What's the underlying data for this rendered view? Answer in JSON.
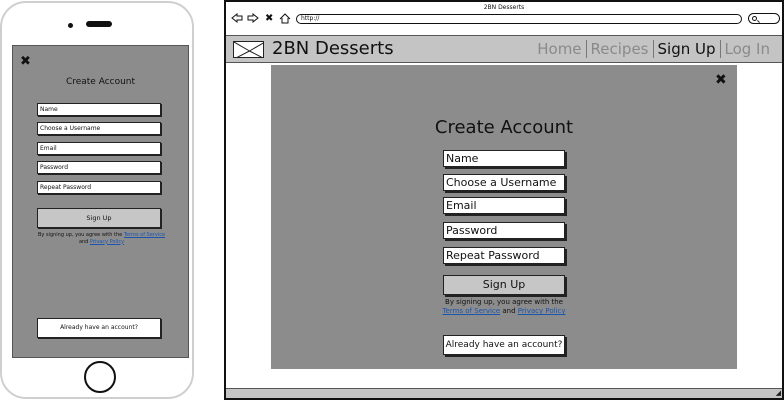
{
  "phone": {
    "close_icon": "close-icon",
    "title": "Create Account",
    "fields": [
      "Name",
      "Choose a Username",
      "Email",
      "Password",
      "Repeat Password"
    ],
    "signup_label": "Sign Up",
    "terms_prefix": "By signing up, you agree with the",
    "terms_link": "Terms of Service",
    "terms_and": "and",
    "privacy_link": "Privacy Policy",
    "account_label": "Already have an account?"
  },
  "browser": {
    "window_title": "2BN Desserts",
    "url": "http://",
    "site_title": "2BN Desserts",
    "nav": [
      "Home",
      "Recipes",
      "Sign Up",
      "Log In"
    ],
    "modal": {
      "title": "Create Account",
      "fields": [
        "Name",
        "Choose a Username",
        "Email",
        "Password",
        "Repeat Password"
      ],
      "signup_label": "Sign Up",
      "terms_prefix": "By signing up, you agree with the",
      "terms_link": "Terms of Service",
      "terms_and": "and",
      "privacy_link": "Privacy Policy",
      "account_label": "Already have an account?"
    }
  },
  "colors": {
    "modal_bg": "#8c8c8c",
    "navbar_bg": "#c4c4c4",
    "link": "#1a55b0",
    "nav_dim": "#8a8a8a"
  }
}
